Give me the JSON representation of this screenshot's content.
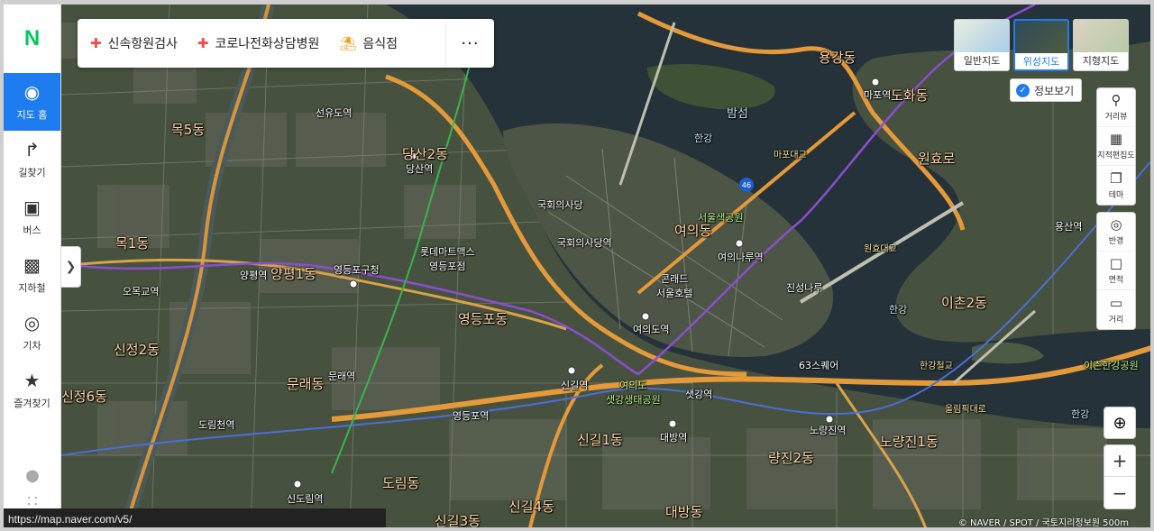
{
  "sidebar": {
    "logo": "N",
    "items": [
      {
        "label": "지도 홈",
        "icon": "map-home-icon",
        "active": true
      },
      {
        "label": "길찾기",
        "icon": "directions-icon"
      },
      {
        "label": "버스",
        "icon": "bus-icon"
      },
      {
        "label": "지하철",
        "icon": "subway-icon"
      },
      {
        "label": "기차",
        "icon": "train-icon"
      },
      {
        "label": "즐겨찾기",
        "icon": "star-icon"
      }
    ]
  },
  "chips": {
    "items": [
      "신속항원검사",
      "코로나전화상담병원",
      "음식점"
    ],
    "more": "···"
  },
  "map_type": {
    "options": [
      "일반지도",
      "위성지도",
      "지형지도"
    ],
    "selected": "위성지도"
  },
  "info_view": "정보보기",
  "tools": [
    "거리뷰",
    "지적편집도",
    "테마",
    "반경",
    "면적",
    "거리"
  ],
  "zoom": {
    "in": "+",
    "out": "−"
  },
  "status_url": "https://map.naver.com/v5/",
  "copyright": "© NAVER / SPOT / 국토지리정보원   500m",
  "map_labels": {
    "yeouido": "여의동",
    "dangsan": "당산2동",
    "yangpyeong": "양평1동",
    "mullae": "문래동",
    "yeongdeungpo": "영등포동",
    "singil1": "신길1동",
    "dorim": "도림동",
    "daebang": "대방동",
    "noryangjin": "노량진1동",
    "ichon": "이촌2동",
    "yonggang": "용강동",
    "dohwa": "도화동",
    "mok1": "목1동",
    "mok5": "목5동",
    "sinjeong2": "신정2동",
    "singil4": "신길4동",
    "singil3": "신길3동",
    "nangjin2": "량진2동",
    "wonhyo": "원효로",
    "sinjeong6": "신정6동",
    "bamseom": "밤섬",
    "hangang1": "한강",
    "hangang2": "한강",
    "hangang3": "한강",
    "assembly": "국회의사당",
    "assembly_st": "국회의사당역",
    "yeouinaru": "여의나루역",
    "yeouido_st": "여의도역",
    "lotte": "롯데마트맥스\n영등포점",
    "yeongdeungpo_office": "영등포구청",
    "dangsan_st": "당산역",
    "yangpyeong_st": "양평역",
    "omokgyo": "오목교역",
    "singil_st": "신길역",
    "saetgang_st": "샛강역",
    "daebang_st": "대방역",
    "noryangjin_st": "노량진역",
    "mapo_st": "마포역",
    "yongsan_st": "용산역",
    "sindorim_st": "신도림역",
    "dorimcheon_st": "도림천역",
    "mullae_st": "문래역",
    "yeongdeungpo_st": "영등포역",
    "seonyu_st": "선유도역",
    "hanggang_park": "이촌한강공원",
    "seoulsup": "서울색공원",
    "saetgang_park": "여의도\n샛강생태공원",
    "jinseong": "진성나루",
    "sixtythree": "63스퀘어",
    "conrad": "콘래드\n서울호텔",
    "olympic": "올림픽대로",
    "mapodaero": "마포대교",
    "wonhyodaegyo": "원효대교",
    "hangangcheolgyo": "한강철교"
  }
}
